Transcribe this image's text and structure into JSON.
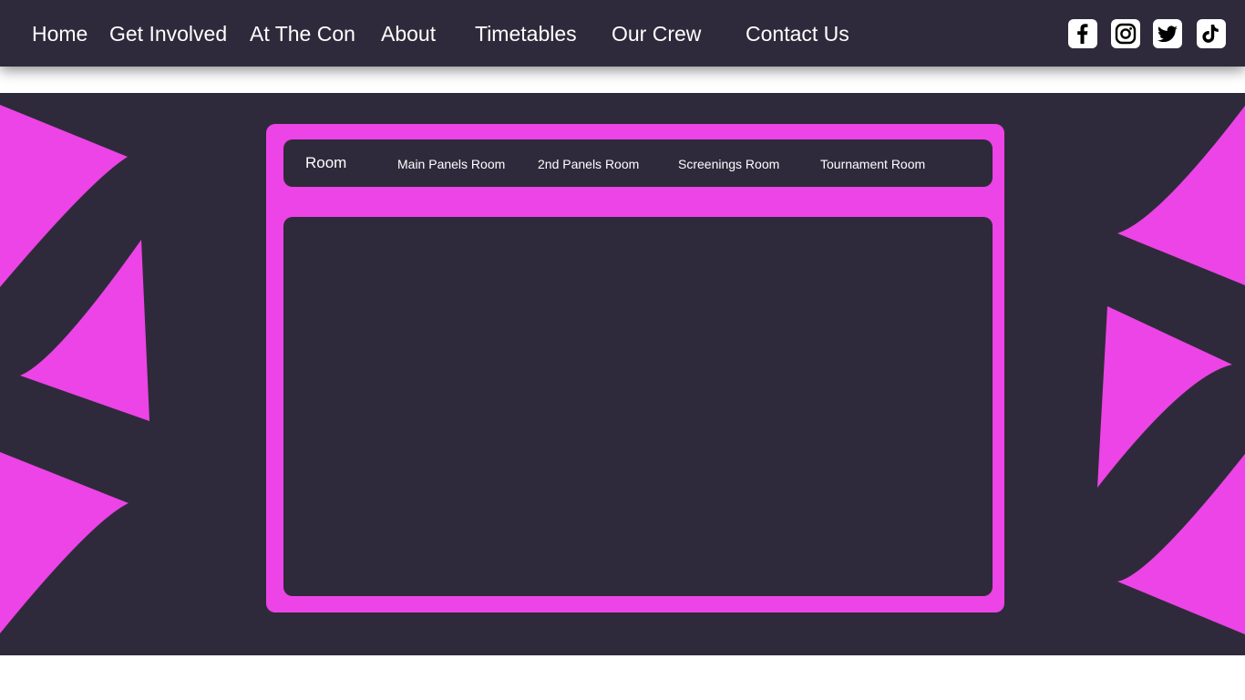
{
  "colors": {
    "dark": "#2f2a3b",
    "accent": "#ec44e6",
    "text": "#ffffff"
  },
  "nav": {
    "links": [
      "Home",
      "Get Involved",
      "At The Con",
      "About",
      "Timetables",
      "Our Crew",
      "Contact Us"
    ]
  },
  "social": {
    "icons": [
      "facebook-icon",
      "instagram-icon",
      "twitter-icon",
      "tiktok-icon"
    ]
  },
  "room_panel": {
    "title": "Room",
    "tabs": [
      "Main Panels Room",
      "2nd Panels Room",
      "Screenings Room",
      "Tournament Room"
    ]
  }
}
